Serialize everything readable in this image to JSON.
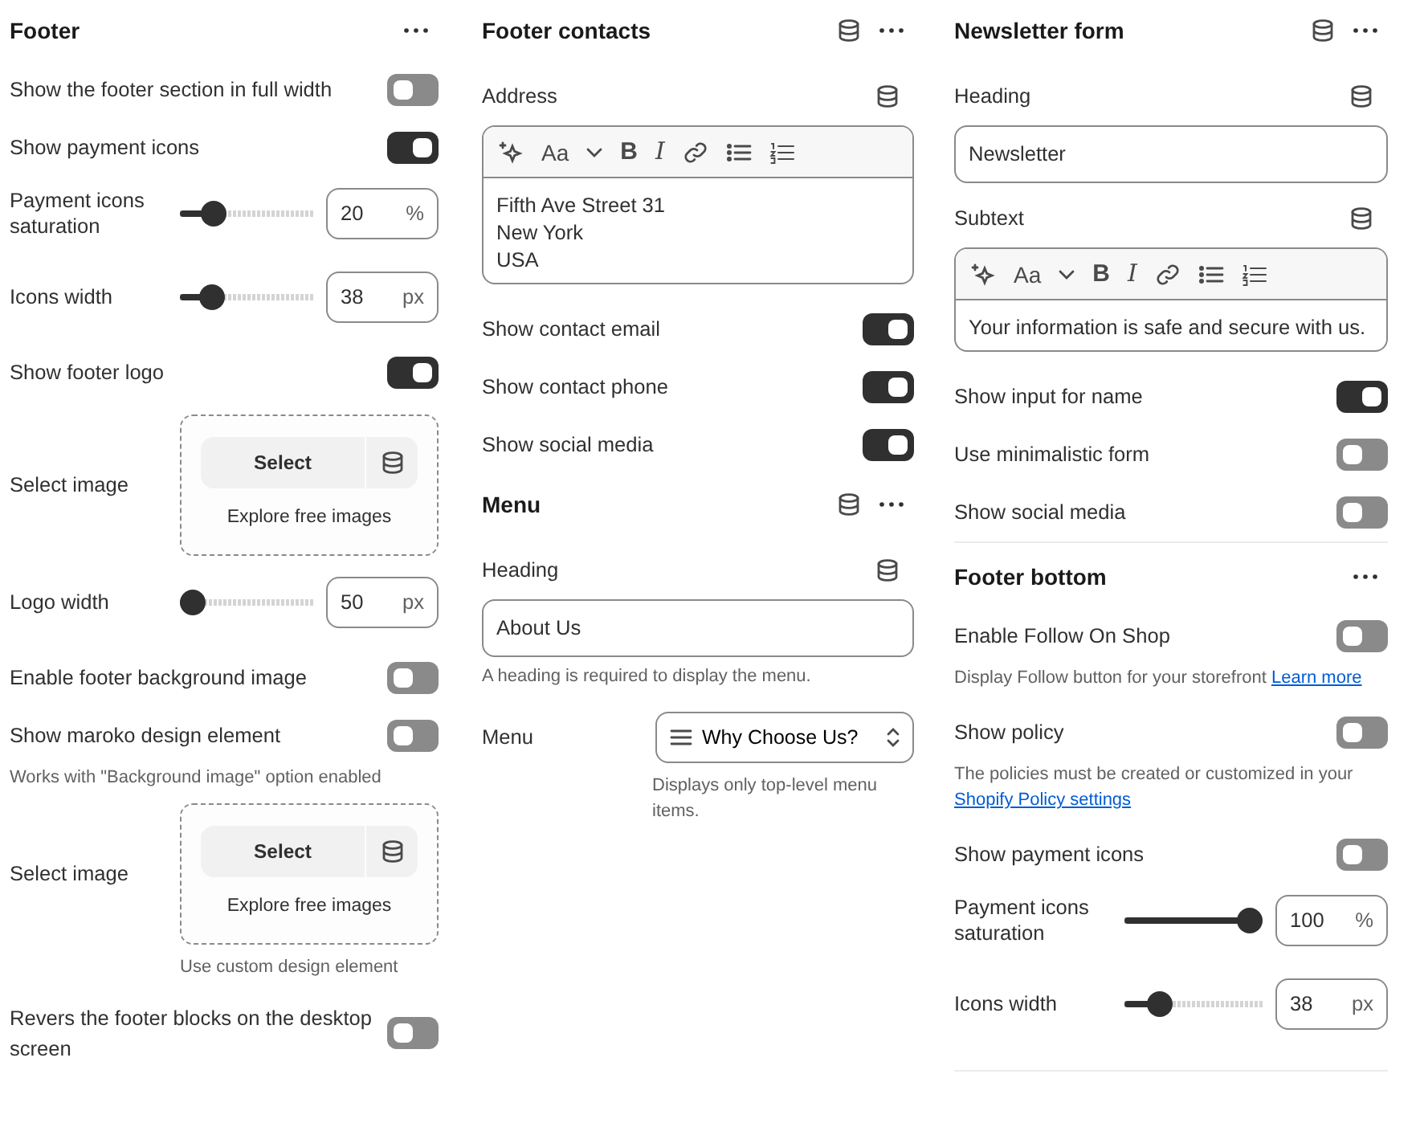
{
  "columns": [
    {
      "sections": [
        {
          "title": "Footer",
          "db_icon": false,
          "items": [
            {
              "kind": "toggle",
              "label": "Show the footer section in full width",
              "on": false
            },
            {
              "kind": "toggle",
              "label": "Show payment icons",
              "on": true
            },
            {
              "kind": "slider",
              "label": "Payment icons saturation",
              "level": 0.2,
              "value": "20",
              "unit": "%"
            },
            {
              "kind": "slider",
              "label": "Icons width",
              "level": 0.18,
              "value": "38",
              "unit": "px"
            },
            {
              "kind": "toggle",
              "label": "Show footer logo",
              "on": true
            },
            {
              "kind": "image_picker",
              "label": "Select image",
              "button": "Select",
              "explore": "Explore free images"
            },
            {
              "kind": "slider",
              "label": "Logo width",
              "level": 0,
              "value": "50",
              "unit": "px"
            },
            {
              "kind": "toggle",
              "label": "Enable footer background image",
              "on": false
            },
            {
              "kind": "toggle",
              "label": "Show maroko design element",
              "on": false,
              "note": "Works with \"Background image\" option enabled"
            },
            {
              "kind": "image_picker",
              "label": "Select image",
              "button": "Select",
              "explore": "Explore free images",
              "note": "Use custom design element"
            },
            {
              "kind": "toggle",
              "label": "Revers the footer blocks on the desktop screen",
              "on": false
            }
          ]
        }
      ]
    },
    {
      "sections": [
        {
          "title": "Footer contacts",
          "db_icon": true,
          "items": [
            {
              "kind": "richtext",
              "label": "Address",
              "font_glyph": "Aa",
              "bold_glyph": "B",
              "italic_glyph": "I",
              "lines": [
                "Fifth Ave Street 31",
                "New York",
                "USA"
              ]
            },
            {
              "kind": "toggle",
              "label": "Show contact email",
              "on": true
            },
            {
              "kind": "toggle",
              "label": "Show contact phone",
              "on": true
            },
            {
              "kind": "toggle",
              "label": "Show social media",
              "on": true
            }
          ]
        },
        {
          "title": "Menu",
          "db_icon": true,
          "items": [
            {
              "kind": "text_field",
              "label": "Heading",
              "value": "About Us",
              "note": "A heading is required to display the menu."
            },
            {
              "kind": "menu_picker",
              "label": "Menu",
              "value": "Why Choose Us?",
              "note": "Displays only top-level menu items."
            }
          ]
        }
      ]
    },
    {
      "sections": [
        {
          "title": "Newsletter form",
          "db_icon": true,
          "items": [
            {
              "kind": "text_field",
              "label": "Heading",
              "value": "Newsletter"
            },
            {
              "kind": "richtext",
              "label": "Subtext",
              "font_glyph": "Aa",
              "bold_glyph": "B",
              "italic_glyph": "I",
              "lines": [
                "Your information is safe and secure with us."
              ]
            },
            {
              "kind": "toggle",
              "label": "Show input for name",
              "on": true
            },
            {
              "kind": "toggle",
              "label": "Use minimalistic form",
              "on": false
            },
            {
              "kind": "toggle",
              "label": "Show social media",
              "on": false
            }
          ]
        },
        {
          "title": "Footer bottom",
          "db_icon": false,
          "items": [
            {
              "kind": "toggle",
              "label": "Enable Follow On Shop",
              "on": false,
              "note": "Display Follow button for your storefront",
              "note_link": "Learn more"
            },
            {
              "kind": "toggle",
              "label": "Show policy",
              "on": false,
              "note": "The policies must be created or customized in your",
              "note_link": "Shopify Policy settings"
            },
            {
              "kind": "toggle",
              "label": "Show payment icons",
              "on": false
            },
            {
              "kind": "slider",
              "label": "Payment icons saturation",
              "level": 1,
              "value": "100",
              "unit": "%"
            },
            {
              "kind": "slider",
              "label": "Icons width",
              "level": 0.2,
              "value": "38",
              "unit": "px"
            }
          ]
        }
      ]
    }
  ]
}
